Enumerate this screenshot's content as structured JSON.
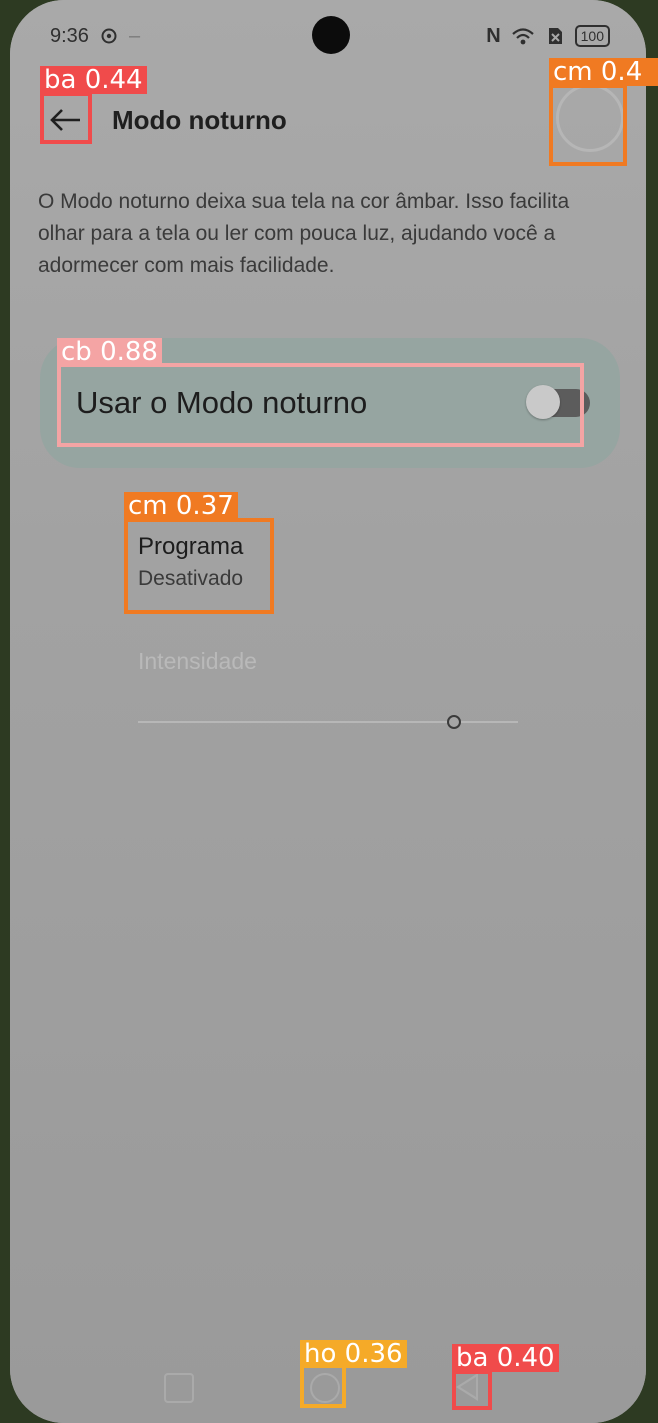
{
  "status_bar": {
    "time": "9:36",
    "battery": "100",
    "nfc_label": "N"
  },
  "header": {
    "title": "Modo noturno"
  },
  "description": "O Modo noturno deixa sua tela na cor âmbar. Isso facilita olhar para a tela ou ler com pouca luz, ajudando você a adormecer com mais facilidade.",
  "night_mode_toggle": {
    "label": "Usar o Modo noturno",
    "enabled": false
  },
  "schedule": {
    "title": "Programa",
    "value": "Desativado"
  },
  "intensity": {
    "label": "Intensidade",
    "value": 0.83,
    "enabled": false
  },
  "colors": {
    "screen_bg": "#a1a1a1",
    "card_bg": "#96a5a1",
    "det_red": "#f04b4b",
    "det_orange": "#f07a22",
    "det_pink": "#f4a4a4",
    "det_yellow": "#f5aa28"
  },
  "detections": [
    {
      "tag": "ba 0.44",
      "color": "#f04b4b"
    },
    {
      "tag": "cm 0.4",
      "color": "#f07a22"
    },
    {
      "tag": "cb 0.88",
      "color": "#f4a4a4"
    },
    {
      "tag": "cm 0.37",
      "color": "#f07a22"
    },
    {
      "tag": "ho 0.36",
      "color": "#f5aa28"
    },
    {
      "tag": "ba 0.40",
      "color": "#f04b4b"
    }
  ]
}
